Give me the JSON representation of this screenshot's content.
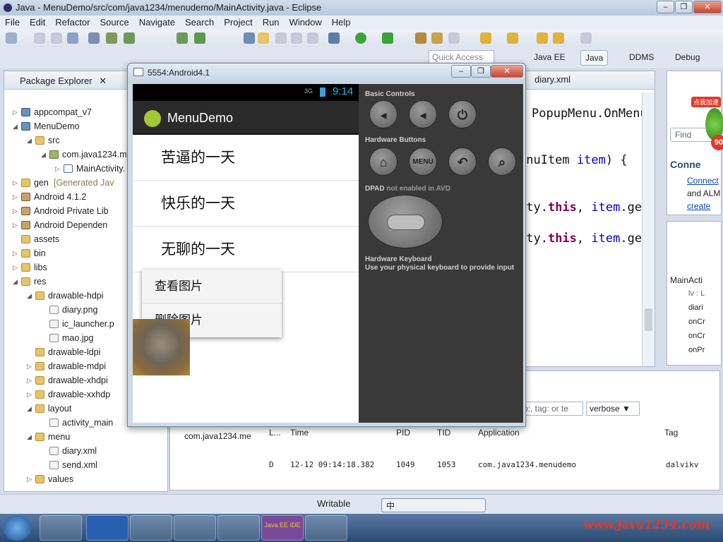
{
  "window": {
    "title": "Java - MenuDemo/src/com/java1234/menudemo/MainActivity.java - Eclipse"
  },
  "menubar": [
    "File",
    "Edit",
    "Refactor",
    "Source",
    "Navigate",
    "Search",
    "Project",
    "Run",
    "Window",
    "Help"
  ],
  "quick_access": {
    "placeholder": "Quick Access"
  },
  "perspectives": [
    "Java EE",
    "Java",
    "DDMS",
    "Debug"
  ],
  "package_explorer": {
    "title": "Package Explorer",
    "items": [
      "appcompat_v7",
      "MenuDemo",
      "src",
      "com.java1234.m",
      "MainActivity.",
      "gen",
      "[Generated Jav",
      "Android 4.1.2",
      "Android Private Lib",
      "Android Dependen",
      "assets",
      "bin",
      "libs",
      "res",
      "drawable-hdpi",
      "diary.png",
      "ic_launcher.p",
      "mao.jpg",
      "drawable-ldpi",
      "drawable-mdpi",
      "drawable-xhdpi",
      "drawable-xxhdp",
      "layout",
      "activity_main",
      "menu",
      "diary.xml",
      "send.xml",
      "values"
    ]
  },
  "editor": {
    "tab": "diary.xml",
    "lines": {
      "l1": "PopupMenu.OnMenu",
      "l2a": "enuItem ",
      "l2b": "item",
      "l2c": ") {",
      "l3a": "ity.",
      "l3b": "this",
      "l3c": ", ",
      "l3d": "item",
      "l3e": ".ge",
      "l4a": "ity.",
      "l4b": "this",
      "l4c": ", ",
      "l4d": "item",
      "l4e": ".ge"
    }
  },
  "right_panel": {
    "find_placeholder": "Find",
    "connect_title": "Conne",
    "connect_link": "Connect",
    "connect_text": "and ALM",
    "create_link": "create",
    "badge_top": "点我加速",
    "badge_num": "90",
    "outline_title": "MainActi",
    "outline_items": [
      "lv : L",
      "diari",
      "onCr",
      "onCr",
      "onPr"
    ]
  },
  "logcat": {
    "filter_placeholder": "p:, tag: or te",
    "level": "verbose",
    "left_item": "com.java1234.me",
    "columns": [
      "L...",
      "Time",
      "PID",
      "TID",
      "Application",
      "Tag"
    ],
    "rows": [
      {
        "level": "D",
        "time": "12-12 09:14:18.382",
        "pid": "1049",
        "tid": "1053",
        "app": "com.java1234.menudemo",
        "tag": "dalvikv"
      }
    ]
  },
  "statusbar": {
    "writable": "Writable",
    "ime": "中"
  },
  "emulator": {
    "title": "5554:Android4.1",
    "status_time": "9:14",
    "status_signal": "3G",
    "app_title": "MenuDemo",
    "list": [
      "苦逼的一天",
      "快乐的一天",
      "无聊的一天"
    ],
    "popup": [
      "查看图片",
      "删除图片"
    ],
    "controls": {
      "basic": "Basic Controls",
      "hardware": "Hardware Buttons",
      "menu_label": "MENU",
      "dpad": "DPAD",
      "dpad_note": "not enabled in AVD",
      "keyboard": "Hardware Keyboard",
      "keyboard_note": "Use your physical keyboard to provide input"
    }
  },
  "watermark": "www.java1234.com",
  "taskbar": {
    "ide_label": "Java EE IDE"
  }
}
